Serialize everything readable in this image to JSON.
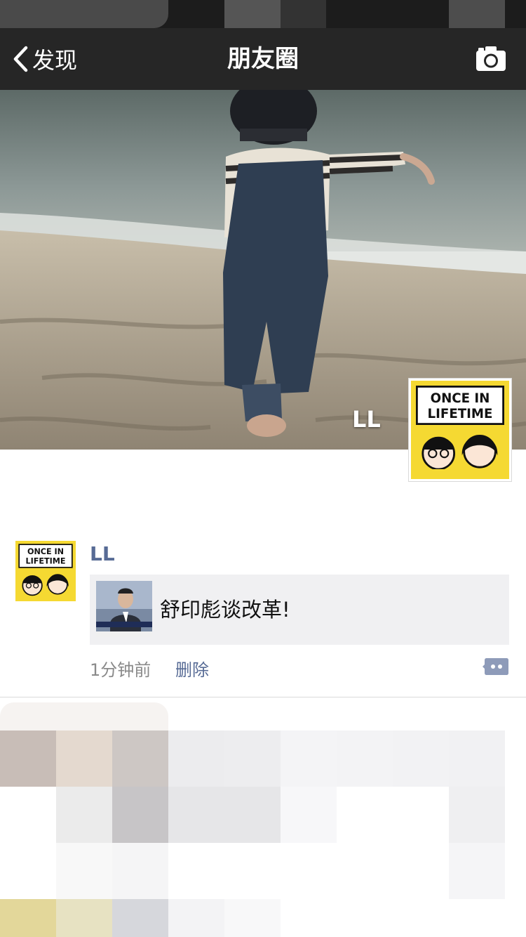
{
  "nav": {
    "back_label": "发现",
    "title": "朋友圈"
  },
  "cover": {
    "user_name": "LL"
  },
  "profile_avatar": {
    "line1": "ONCE IN",
    "line2": "LIFETIME"
  },
  "post": {
    "author": "LL",
    "link_title": "舒印彪谈改革!",
    "time": "1分钟前",
    "delete_label": "删除"
  },
  "colors": {
    "nav_bg": "#262626",
    "link_blue": "#576b95",
    "card_bg": "#f0f0f2",
    "avatar_yellow": "#f5d932"
  }
}
